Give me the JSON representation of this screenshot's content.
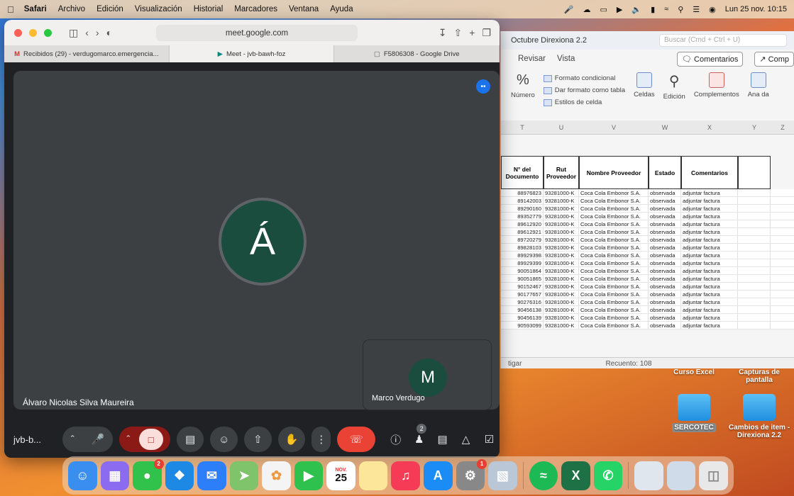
{
  "menubar": {
    "app": "Safari",
    "items": [
      "Archivo",
      "Edición",
      "Visualización",
      "Historial",
      "Marcadores",
      "Ventana",
      "Ayuda"
    ],
    "clock": "Lun 25 nov.  10:15"
  },
  "safari": {
    "url": "meet.google.com",
    "tabs": [
      "Recibidos (29) - verdugomarco.emergencia...",
      "Meet - jvb-bawh-foz",
      "F5806308 - Google Drive"
    ]
  },
  "meet": {
    "main_initial": "Á",
    "main_name": "Álvaro Nicolas Silva Maureira",
    "self_initial": "M",
    "self_name": "Marco Verdugo",
    "meeting_code": "jvb-b...",
    "participants_badge": "2"
  },
  "excel": {
    "title": "Octubre Direxiona 2.2",
    "search": "Buscar (Cmd + Ctrl + U)",
    "tabs": [
      "Revisar",
      "Vista"
    ],
    "comments_btn": "Comentarios",
    "share_btn": "Comp",
    "ribbon": {
      "numero": "Número",
      "fmt_cond": "Formato condicional",
      "fmt_tabla": "Dar formato como tabla",
      "estilos": "Estilos de celda",
      "celdas": "Celdas",
      "edicion": "Edición",
      "complementos": "Complementos",
      "analizar": "Ana da"
    },
    "columns": [
      "T",
      "U",
      "V",
      "W",
      "X",
      "Y",
      "Z"
    ],
    "headers": [
      "N° del Documento",
      "Rut Proveedor",
      "Nombre Proveedor",
      "Estado",
      "Comentarios",
      ""
    ],
    "rows": [
      [
        "88976823",
        "93281000-K",
        "Coca Cola Embonor S.A.",
        "observada",
        "adjuntar factura"
      ],
      [
        "89142003",
        "93281000-K",
        "Coca Cola Embonor S.A.",
        "observada",
        "adjuntar factura"
      ],
      [
        "89290160",
        "93281000-K",
        "Coca Cola Embonor S.A.",
        "observada",
        "adjuntar factura"
      ],
      [
        "89352779",
        "93281000-K",
        "Coca Cola Embonor S.A.",
        "observada",
        "adjuntar factura"
      ],
      [
        "89612920",
        "93281000-K",
        "Coca Cola Embonor S.A.",
        "observada",
        "adjuntar factura"
      ],
      [
        "89612921",
        "93281000-K",
        "Coca Cola Embonor S.A.",
        "observada",
        "adjuntar factura"
      ],
      [
        "89720279",
        "93281000-K",
        "Coca Cola Embonor S.A.",
        "observada",
        "adjuntar factura"
      ],
      [
        "89828103",
        "93281000-K",
        "Coca Cola Embonor S.A.",
        "observada",
        "adjuntar factura"
      ],
      [
        "89929398",
        "93281000-K",
        "Coca Cola Embonor S.A.",
        "observada",
        "adjuntar factura"
      ],
      [
        "89929399",
        "93281000-K",
        "Coca Cola Embonor S.A.",
        "observada",
        "adjuntar factura"
      ],
      [
        "90051864",
        "93281000-K",
        "Coca Cola Embonor S.A.",
        "observada",
        "adjuntar factura"
      ],
      [
        "90051865",
        "93281000-K",
        "Coca Cola Embonor S.A.",
        "observada",
        "adjuntar factura"
      ],
      [
        "90152467",
        "93281000-K",
        "Coca Cola Embonor S.A.",
        "observada",
        "adjuntar factura"
      ],
      [
        "90177657",
        "93281000-K",
        "Coca Cola Embonor S.A.",
        "observada",
        "adjuntar factura"
      ],
      [
        "90276316",
        "93281000-K",
        "Coca Cola Embonor S.A.",
        "observada",
        "adjuntar factura"
      ],
      [
        "90456138",
        "93281000-K",
        "Coca Cola Embonor S.A.",
        "observada",
        "adjuntar factura"
      ],
      [
        "90456139",
        "93281000-K",
        "Coca Cola Embonor S.A.",
        "observada",
        "adjuntar factura"
      ],
      [
        "90593099",
        "93281000-K",
        "Coca Cola Embonor S.A.",
        "observada",
        "adjuntar factura"
      ]
    ],
    "status_left": "tigar",
    "status_count": "Recuento: 108"
  },
  "desktop": {
    "icons": [
      "Curso Excel",
      "Capturas de pantalla",
      "SERCOTEC",
      "Cambios de item - Direxiona 2.2"
    ]
  },
  "dock": {
    "calendar_month": "NOV.",
    "calendar_day": "25",
    "messages_badge": "2",
    "settings_badge": "1"
  }
}
